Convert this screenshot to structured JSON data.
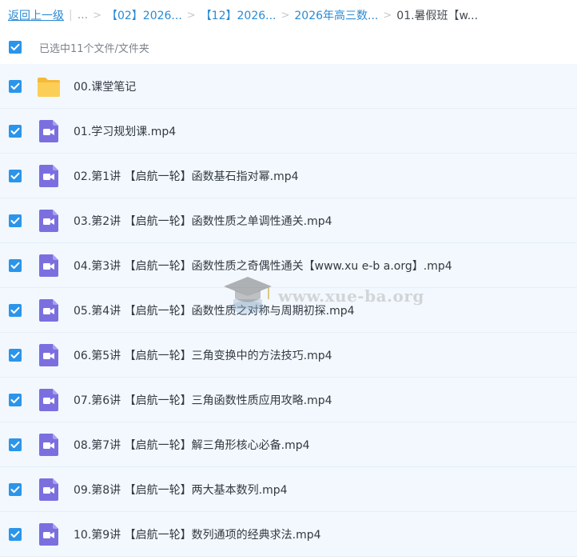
{
  "breadcrumb": {
    "back_label": "返回上一级",
    "ellipsis": "...",
    "crumbs": [
      "【02】2026...",
      "【12】2026...",
      "2026年高三数..."
    ],
    "current": "01.暑假班【w..."
  },
  "selection": {
    "text": "已选中11个文件/文件夹"
  },
  "files": [
    {
      "name": "00.课堂笔记",
      "type": "folder"
    },
    {
      "name": "01.学习规划课.mp4",
      "type": "video"
    },
    {
      "name": "02.第1讲 【启航一轮】函数基石指对幂.mp4",
      "type": "video"
    },
    {
      "name": "03.第2讲 【启航一轮】函数性质之单调性通关.mp4",
      "type": "video"
    },
    {
      "name": "04.第3讲 【启航一轮】函数性质之奇偶性通关【www.xu e-b a.org】.mp4",
      "type": "video"
    },
    {
      "name": "05.第4讲 【启航一轮】函数性质之对称与周期初探.mp4",
      "type": "video"
    },
    {
      "name": "06.第5讲 【启航一轮】三角变换中的方法技巧.mp4",
      "type": "video"
    },
    {
      "name": "07.第6讲 【启航一轮】三角函数性质应用攻略.mp4",
      "type": "video"
    },
    {
      "name": "08.第7讲 【启航一轮】解三角形核心必备.mp4",
      "type": "video"
    },
    {
      "name": "09.第8讲 【启航一轮】两大基本数列.mp4",
      "type": "video"
    },
    {
      "name": "10.第9讲 【启航一轮】数列通项的经典求法.mp4",
      "type": "video"
    }
  ],
  "watermark": {
    "text": "www.xue-ba.org"
  },
  "colors": {
    "link": "#2a8ad4",
    "checkbox": "#2b95ea",
    "row_bg": "#f2f8fe",
    "folder": "#f8c94d",
    "video": "#7b6fe0"
  },
  "icons": {
    "checkbox": "check-icon",
    "folder": "folder-icon",
    "video": "video-file-icon"
  }
}
